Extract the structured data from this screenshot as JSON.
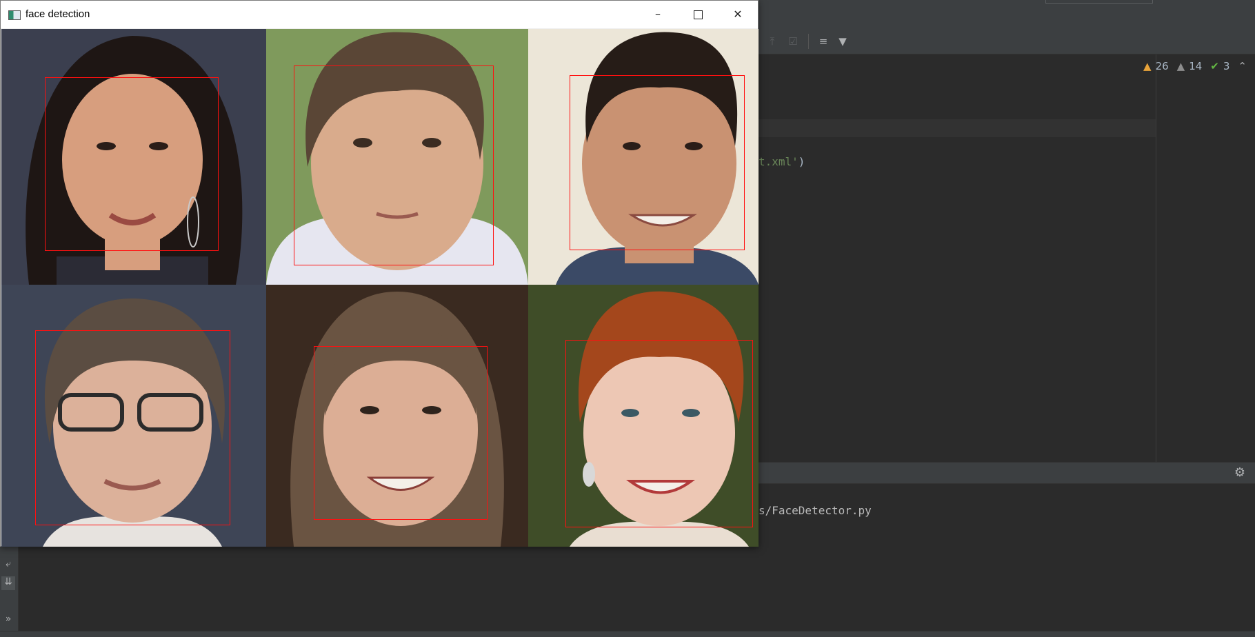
{
  "window": {
    "title": "face detection",
    "controls": {
      "minimize": "–",
      "maximize": "",
      "close": "✕"
    }
  },
  "ide": {
    "inspections": {
      "warnings": "26",
      "weak_warnings": "14",
      "typos": "3"
    },
    "code_fragment": {
      "string": "t.xml'",
      "paren": ")"
    },
    "run_output": "s/FaceDetector.py",
    "toolbar_icons": [
      "expand-icon",
      "checklist-icon",
      "sort-icon",
      "filter-icon"
    ]
  },
  "faces": {
    "count": "6",
    "box_color": "#ff1010",
    "tiles": [
      {
        "name": "woman-dark-hair",
        "bg": "#3b3f4f",
        "hair": "#1e1614",
        "skin": "#d79e7e",
        "shirt": "#2b2b35"
      },
      {
        "name": "boy-short-hair",
        "bg": "#7f9a5c",
        "hair": "#5a4636",
        "skin": "#d9ab8c",
        "shirt": "#e6e6f0"
      },
      {
        "name": "man-smiling",
        "bg": "#ece6d8",
        "hair": "#261c17",
        "skin": "#c99272",
        "shirt": "#3b4a66"
      },
      {
        "name": "woman-glasses",
        "bg": "#3e4556",
        "hair": "#5b4d42",
        "skin": "#dcb19a",
        "shirt": "#e7e3df"
      },
      {
        "name": "woman-long-hair",
        "bg": "#3a2a20",
        "hair": "#6a5442",
        "skin": "#dcae95",
        "shirt": "#3a2a20"
      },
      {
        "name": "woman-red-hair",
        "bg": "#3f4d28",
        "hair": "#a4471c",
        "skin": "#edc7b4",
        "shirt": "#e9ded2"
      }
    ]
  }
}
